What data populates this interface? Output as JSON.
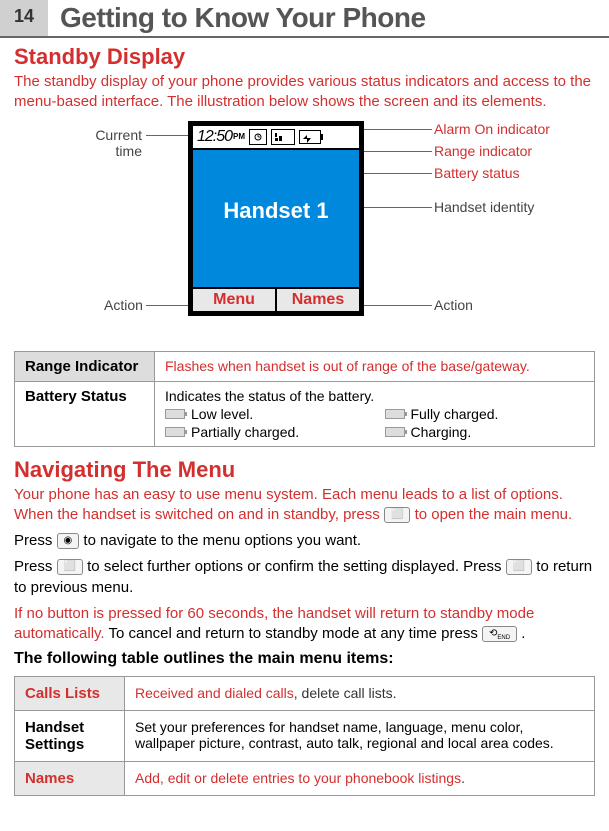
{
  "header": {
    "page_number": "14",
    "title": "Getting to Know Your Phone"
  },
  "section1": {
    "title": "Standby Display",
    "intro_part1": "The ",
    "intro_highlight": "standby",
    "intro_part2": " display of your phone provides various status indicators and access to the menu-based interface. The illustration below shows the screen and its elements."
  },
  "diagram": {
    "time": "12:50",
    "time_suffix": "PM",
    "handset_label": "Handset  1",
    "softkey_left": "Menu",
    "softkey_right": "Names",
    "callouts": {
      "current_time": "Current time",
      "alarm": "Alarm On indicator",
      "range": "Range indicator",
      "battery": "Battery status",
      "identity": "Handset identity",
      "action_left": "Action",
      "action_right": "Action"
    }
  },
  "status_table": {
    "range_label": "Range Indicator",
    "range_desc": "Flashes when handset is out of range of the base/gateway.",
    "battery_label": "Battery Status",
    "battery_desc": "Indicates the status of the battery.",
    "battery_states": {
      "low": "Low level.",
      "full": "Fully charged.",
      "partial": "Partially charged.",
      "charging": "Charging."
    }
  },
  "section2": {
    "title": "Navigating The Menu",
    "p1": "Your phone has an easy to use menu system. Each menu leads to a list of options. When the handset is switched on and in standby, press ",
    "p1_end": " to open the main menu.",
    "p2a": "Press ",
    "p2b": " to navigate to the menu options you want.",
    "p3a": "Press ",
    "p3b": " to select further options or confirm the setting displayed. Press ",
    "p3c": " to return to previous menu.",
    "p4a": "If no button is pressed for 60 seconds, the handset will return to standby mode automatically.",
    "p4b": " To cancel and return to standby mode at any time press ",
    "p4c": " .",
    "table_intro": "The following table outlines the main menu items:"
  },
  "menu_table": {
    "rows": [
      {
        "label": "Calls Lists",
        "desc": "Received and dialed calls, delete call lists.",
        "red": true,
        "desc_dark": ", delete call lists.",
        "desc_red": "Received and dialed calls"
      },
      {
        "label": "Handset Settings",
        "desc": "Set your preferences for handset name, language, menu color, wallpaper picture, contrast, auto talk, regional and local area codes.",
        "red": false
      },
      {
        "label": "Names",
        "desc": "Add, edit or delete entries to your phonebook listings.",
        "red": true,
        "desc_red": "Add, edit or delete entries to your phonebook listings",
        "desc_dark": "."
      }
    ]
  }
}
